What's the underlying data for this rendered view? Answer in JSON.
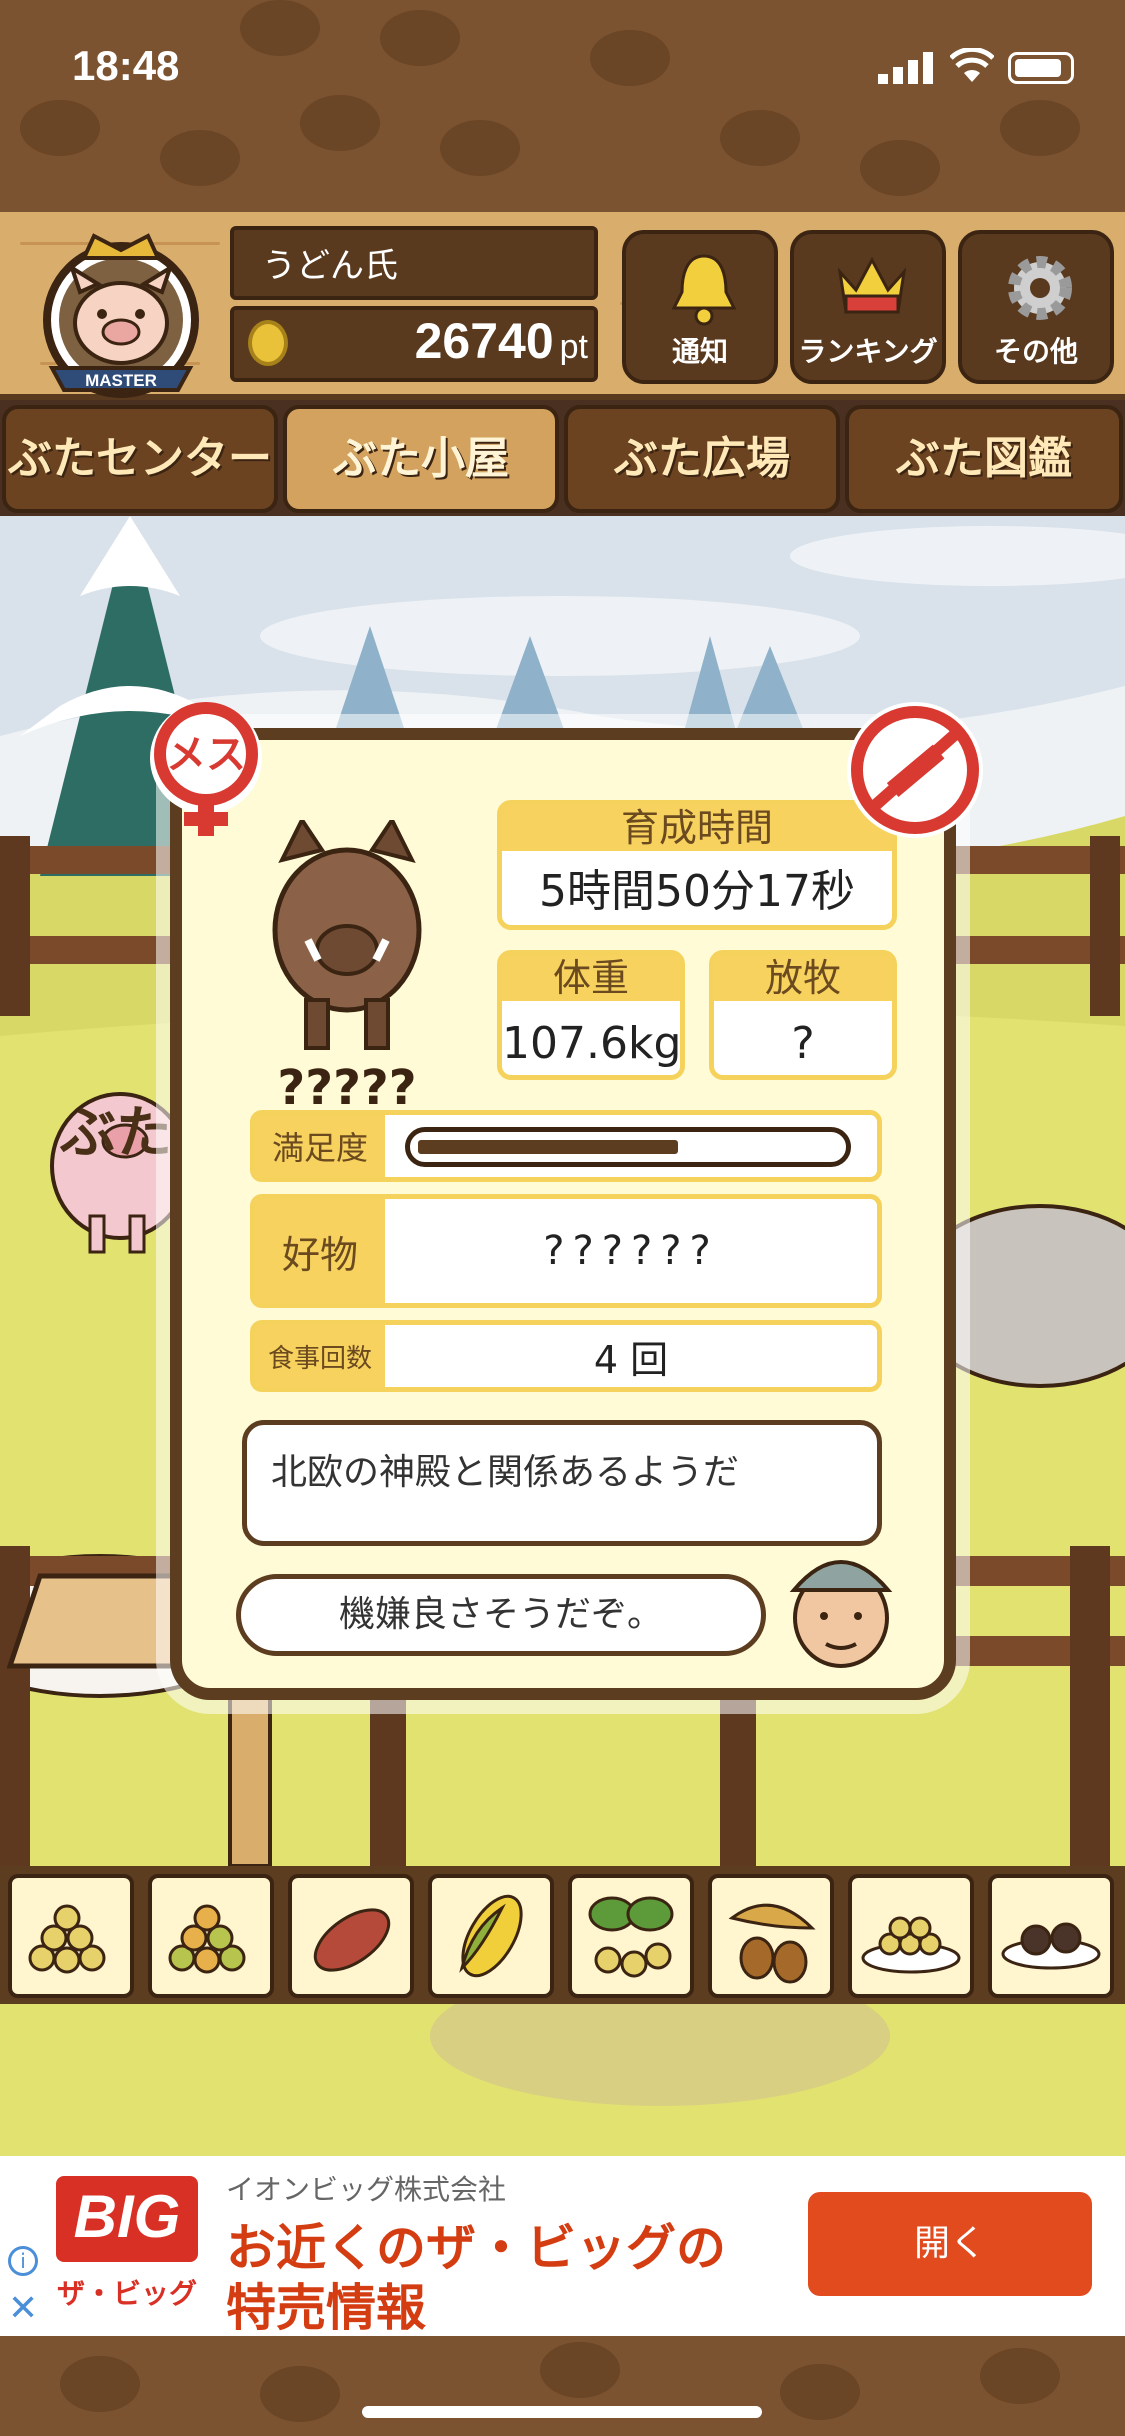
{
  "status": {
    "time": "18:48"
  },
  "header": {
    "badge_label": "MASTER",
    "user_name": "うどん氏",
    "points": "26740",
    "points_unit": "pt",
    "buttons": [
      {
        "label": "通知",
        "icon": "bell-icon"
      },
      {
        "label": "ランキング",
        "icon": "crown-icon"
      },
      {
        "label": "その他",
        "icon": "gear-icon"
      }
    ]
  },
  "tabs": [
    {
      "label": "ぶたセンター",
      "active": false
    },
    {
      "label": "ぶた小屋",
      "active": true
    },
    {
      "label": "ぶた広場",
      "active": false
    },
    {
      "label": "ぶた図鑑",
      "active": false
    }
  ],
  "popup": {
    "gender_label": "メス",
    "pig_name": "?????",
    "raise_time": {
      "label": "育成時間",
      "value": "5時間50分17秒"
    },
    "weight": {
      "label": "体重",
      "value": "107.6kg"
    },
    "pasture": {
      "label": "放牧",
      "value": "?"
    },
    "satisfaction": {
      "label": "満足度",
      "level": 0.62
    },
    "favorite": {
      "label": "好物",
      "value": "??????"
    },
    "meals": {
      "label": "食事回数",
      "value": "4 回"
    },
    "description": "北欧の神殿と関係あるようだ",
    "farmer_comment": "機嫌良さそうだぞ。"
  },
  "sign": "ぶた小屋",
  "food_items": [
    {
      "icon": "soybean-icon"
    },
    {
      "icon": "mixed-beans-icon"
    },
    {
      "icon": "sweet-potato-icon"
    },
    {
      "icon": "corn-icon"
    },
    {
      "icon": "ginkgo-icon"
    },
    {
      "icon": "acorn-icon"
    },
    {
      "icon": "bean-dish-icon"
    },
    {
      "icon": "truffle-dish-icon"
    }
  ],
  "ad": {
    "logo_text": "BIG",
    "logo_sub": "ザ・ビッグ",
    "company": "イオンビッグ株式会社",
    "headline_1": "お近くのザ・ビッグの",
    "headline_2": "特売情報",
    "cta": "開く"
  },
  "colors": {
    "wood_dark": "#5c3d20",
    "wood_light": "#d9ad6c",
    "yellow_accent": "#f7d25e",
    "ad_cta": "#e14b1e",
    "ad_text": "#d43d12",
    "female_red": "#d83a32"
  }
}
